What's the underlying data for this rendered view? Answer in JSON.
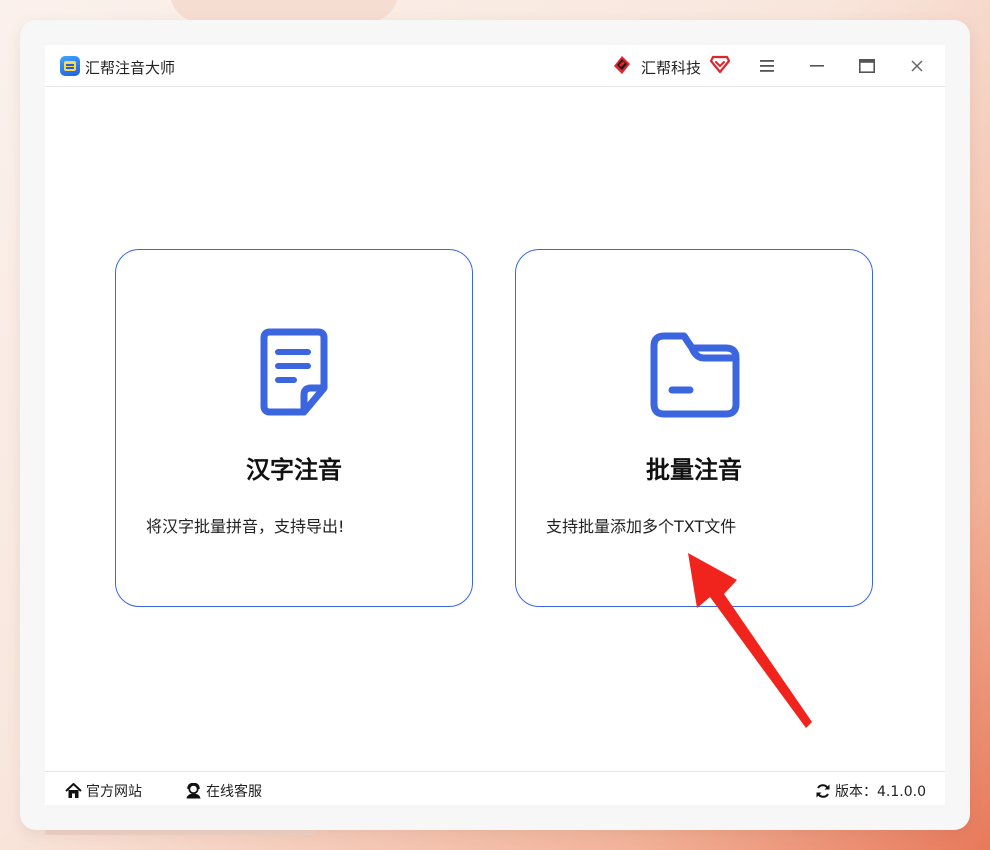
{
  "app": {
    "title": "汇帮注音大师",
    "brand": "汇帮科技"
  },
  "cards": [
    {
      "title": "汉字注音",
      "description": "将汉字批量拼音，支持导出!",
      "icon": "document-icon"
    },
    {
      "title": "批量注音",
      "description": "支持批量添加多个TXT文件",
      "icon": "folder-icon"
    }
  ],
  "footer": {
    "website": "官方网站",
    "service": "在线客服",
    "version_label": "版本：4.1.0.0"
  },
  "colors": {
    "accent": "#3b66e0",
    "annotation_arrow": "#f0241c"
  }
}
